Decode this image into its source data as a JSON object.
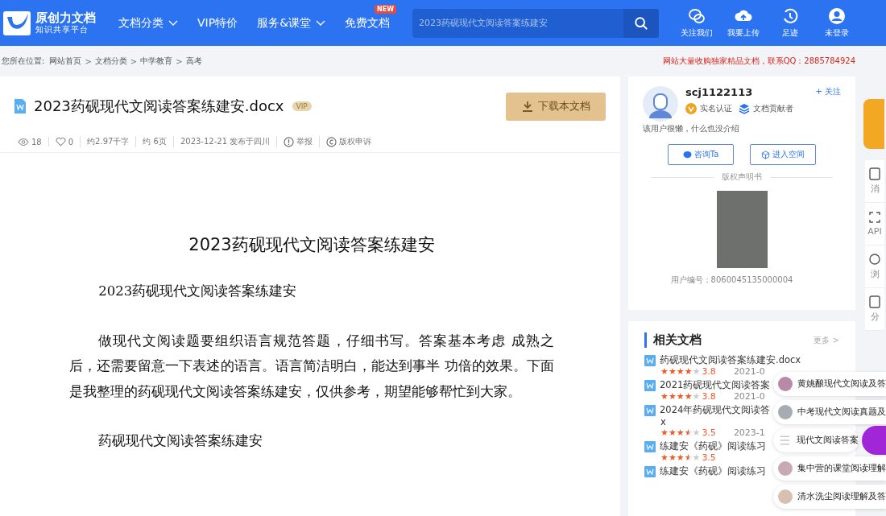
{
  "header": {
    "logo_title": "原创力文档",
    "logo_subtitle": "知识共享平台",
    "nav": [
      {
        "label": "文档分类",
        "dropdown": true
      },
      {
        "label": "VIP特价",
        "dropdown": false
      },
      {
        "label": "服务&课堂",
        "dropdown": true
      },
      {
        "label": "免费文档",
        "dropdown": false,
        "badge": "NEW"
      }
    ],
    "search": {
      "placeholder": "2023药砚现代文阅读答案练建安"
    },
    "actions": [
      {
        "kind": "wechat",
        "label": "关注我们"
      },
      {
        "kind": "upload",
        "label": "我要上传"
      },
      {
        "kind": "history",
        "label": "足迹"
      },
      {
        "kind": "user",
        "label": "未登录"
      }
    ]
  },
  "breadcrumb": {
    "prefix": "您所在位置:",
    "items": [
      "网站首页",
      "文档分类",
      "中学教育",
      "高考"
    ],
    "separator": ">",
    "notice": "网站大量收购独家精品文档，联系QQ：2885784924"
  },
  "document": {
    "title": "2023药砚现代文阅读答案练建安.docx",
    "badge": "VIP",
    "download": "下载本文档",
    "meta": [
      {
        "kind": "views",
        "text": "18"
      },
      {
        "kind": "likes",
        "text": "0"
      },
      {
        "kind": "plain",
        "text": "约2.97千字"
      },
      {
        "kind": "plain",
        "text": "约 6页"
      },
      {
        "kind": "plain",
        "text": "2023-12-21 发布于四川"
      },
      {
        "kind": "report",
        "text": "举报"
      },
      {
        "kind": "copyright",
        "text": "版权申诉"
      }
    ],
    "heading": "2023药砚现代文阅读答案练建安",
    "paragraphs": [
      "2023药砚现代文阅读答案练建安",
      "做现代文阅读题要组织语言规范答题，仔细书写。答案基本考虑 成熟之后，还需要留意一下表述的语言。语言简洁明白，能达到事半 功倍的效果。下面是我整理的药砚现代文阅读答案练建安，仅供参考，期望能够帮忙到大家。",
      "药砚现代文阅读答案练建安"
    ]
  },
  "author": {
    "name": "scj1122113",
    "follow": "+ 关注",
    "badges": [
      {
        "kind": "verified",
        "text": "实名认证"
      },
      {
        "kind": "contributor",
        "text": "文档贡献者"
      }
    ],
    "bio": "该用户很懒，什么也没介绍",
    "buttons": [
      {
        "kind": "chat",
        "label": "咨询Ta"
      },
      {
        "kind": "space",
        "label": "进入空间"
      }
    ],
    "statement": "版权声明书",
    "user_id": "用户编号：8060045135000004"
  },
  "related": {
    "title": "相关文档",
    "more": "更多 >",
    "items": [
      {
        "title": "药砚现代文阅读答案练建安.docx",
        "stars": 4,
        "rating": "3.8",
        "date": "2021-0"
      },
      {
        "title": "2021药砚现代文阅读答案",
        "stars": 4,
        "rating": "3.8",
        "date": "2021-0"
      },
      {
        "title": "2024年药砚现代文阅读答",
        "title_end": "x",
        "stars": 3.5,
        "rating": "3.5",
        "date": "2023-1"
      },
      {
        "title": "练建安《药砚》阅读练习",
        "stars": 3.5,
        "rating": "3.5"
      },
      {
        "title": "练建安《药砚》阅读练习"
      }
    ]
  },
  "side_tools": [
    {
      "kind": "doc",
      "label": "消"
    },
    {
      "kind": "api",
      "label": "API"
    },
    {
      "kind": "browse",
      "label": "浏"
    },
    {
      "kind": "share",
      "label": "分"
    }
  ],
  "suggestions": [
    {
      "kind": "avatar",
      "color": "#b88aa8",
      "text": "黄姚酿现代文阅读及答"
    },
    {
      "kind": "avatar",
      "color": "#a9abb3",
      "text": "中考现代文阅读真题及"
    },
    {
      "kind": "list",
      "color": "#c8c8c8",
      "text": "现代文阅读答案"
    },
    {
      "kind": "avatar",
      "color": "#c9a9b4",
      "text": "集中营的课堂阅读理解"
    },
    {
      "kind": "avatar",
      "color": "#d8c0b0",
      "text": "清水洗尘阅读理解及答"
    }
  ]
}
